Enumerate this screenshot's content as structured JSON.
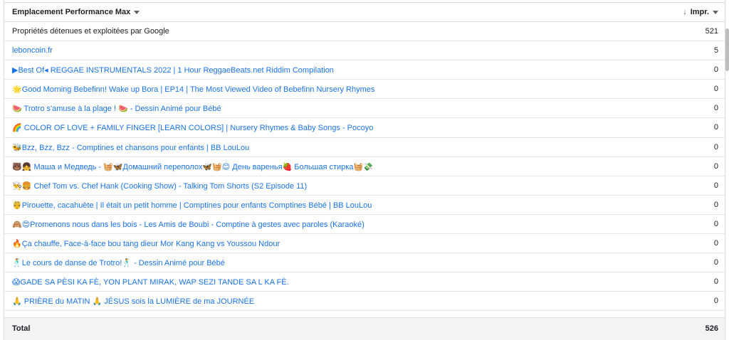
{
  "table": {
    "column_label": "Emplacement Performance Max",
    "metric_label": "Impr.",
    "sort_icon": "arrow-down-icon",
    "rows": [
      {
        "label": "Propriétés détenues et exploitées par Google",
        "value": "521",
        "link": false
      },
      {
        "label": "leboncoin.fr",
        "value": "5",
        "link": true
      },
      {
        "label": "▶Best Of◂ REGGAE INSTRUMENTALS 2022 | 1 Hour ReggaeBeats.net Riddim Compilation",
        "value": "0",
        "link": true
      },
      {
        "label": "🌟Good Morning Bebefinn! Wake up Bora | EP14 | The Most Viewed Video of Bebefinn Nursery Rhymes",
        "value": "0",
        "link": true
      },
      {
        "label": "🍉 Trotro s'amuse à la plage ! 🍉 - Dessin Animé pour Bébé",
        "value": "0",
        "link": true
      },
      {
        "label": "🌈 COLOR OF LOVE + FAMILY FINGER [LEARN COLORS] | Nursery Rhymes & Baby Songs - Pocoyo",
        "value": "0",
        "link": true
      },
      {
        "label": "🐝Bzz, Bzz, Bzz - Comptines et chansons pour enfants | BB LouLou",
        "value": "0",
        "link": true
      },
      {
        "label": "🐻👧 Маша и Медведь - 🧺🦋Домашний переполох🦋🧺😊 День варенья🍓 Большая стирка🧺💸",
        "value": "0",
        "link": true
      },
      {
        "label": "👨‍🍳🍔 Chef Tom vs. Chef Hank (Cooking Show) - Talking Tom Shorts (S2 Episode 11)",
        "value": "0",
        "link": true
      },
      {
        "label": "🤴Pirouette, cacahuète | Il était un petit homme | Comptines pour enfants Comptines Bébé | BB LouLou",
        "value": "0",
        "link": true
      },
      {
        "label": "🙈😍Promenons nous dans les bois - Les Amis de Boubi - Comptine à gestes avec paroles (Karaoké)",
        "value": "0",
        "link": true
      },
      {
        "label": "🔥Ça chauffe, Face-à-face bou tang dieur Mor Kang Kang vs Youssou Ndour",
        "value": "0",
        "link": true
      },
      {
        "label": "🕺Le cours de danse de Trotro!🕺 - Dessin Animé pour Bébé",
        "value": "0",
        "link": true
      },
      {
        "label": "😱GADE SA PÈSI KA FÈ, YON PLANT MIRAK, WAP SEZI TANDE SA L KA FÈ.",
        "value": "0",
        "link": true
      },
      {
        "label": "🙏 PRIÈRE du MATIN 🙏 JÉSUS sois la LUMIÈRE de ma JOURNÉE",
        "value": "0",
        "link": true
      }
    ],
    "total_label": "Total",
    "total_value": "526"
  },
  "colors": {
    "link": "#1a73e8",
    "text": "#202124",
    "total_bg": "#f1f3f4",
    "border": "#dadce0"
  }
}
